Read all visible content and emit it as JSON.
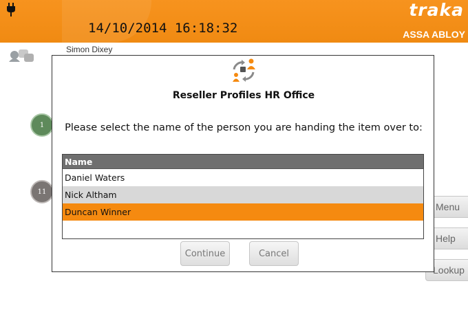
{
  "header": {
    "datetime": "14/10/2014 16:18:32",
    "brand_top": "traka",
    "brand_bottom": "ASSA ABLOY"
  },
  "user": {
    "name": "Simon Dixey"
  },
  "background": {
    "badges": [
      "1",
      "11"
    ]
  },
  "side_buttons": {
    "menu": "Menu",
    "help": "Help",
    "lookup": "Lookup"
  },
  "dialog": {
    "title": "Reseller Profiles HR Office",
    "prompt": "Please select the name of the person you are handing the item over to:",
    "list": {
      "header": "Name",
      "rows": [
        "Daniel Waters",
        "Nick Altham",
        "Duncan Winner"
      ],
      "selected_index": 2
    },
    "buttons": {
      "continue": "Continue",
      "cancel": "Cancel"
    }
  },
  "colors": {
    "accent": "#f58a10",
    "header_bg": "#f7931e",
    "list_header_bg": "#6f6f6f",
    "row_alt": "#d8d8d8"
  },
  "icons": {
    "header": "plug-icon",
    "user": "users-icon",
    "dialog": "handover-icon"
  }
}
